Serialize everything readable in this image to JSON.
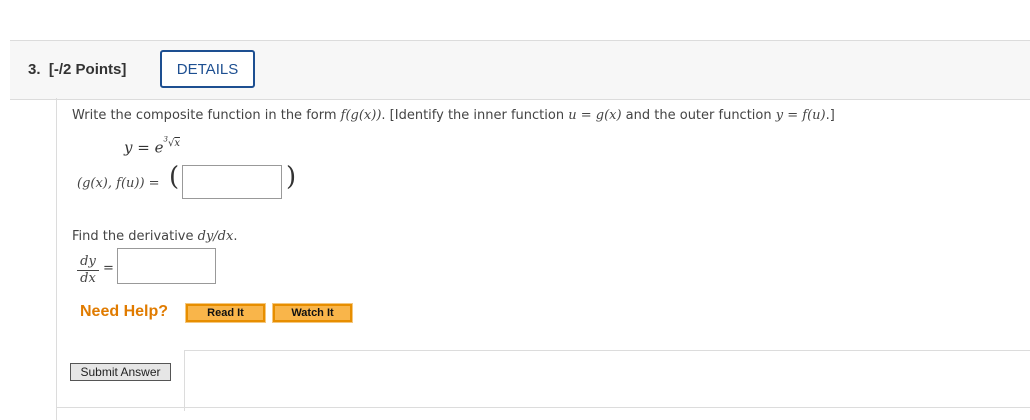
{
  "question": {
    "number_label": "3.",
    "points_label": "[-/2 Points]",
    "details_label": "DETAILS"
  },
  "prompt": {
    "line1_a": "Write the composite function in the form ",
    "line1_form": "f(g(x))",
    "line1_b": ". [Identify the inner function ",
    "line1_inner": "u = g(x)",
    "line1_c": " and the outer function ",
    "line1_outer": "y = f(u)",
    "line1_d": ".]"
  },
  "formula": {
    "lhs": "y = e",
    "root_index": "3",
    "radical": "√",
    "radicand": "x"
  },
  "composite": {
    "label": "(g(x), f(u)) =",
    "open_paren": "(",
    "close_paren": ")",
    "answer_value": ""
  },
  "derivative": {
    "prompt_a": "Find the derivative ",
    "prompt_expr": "dy/dx",
    "prompt_b": ".",
    "frac_num": "dy",
    "frac_den": "dx",
    "equals": "=",
    "answer_value": ""
  },
  "help": {
    "label": "Need Help?",
    "read_it": "Read It",
    "watch_it": "Watch It"
  },
  "submit": {
    "label": "Submit Answer"
  },
  "colors": {
    "details_border": "#1d4f91",
    "help_text": "#e07b00",
    "help_button": "#f9b54a"
  }
}
